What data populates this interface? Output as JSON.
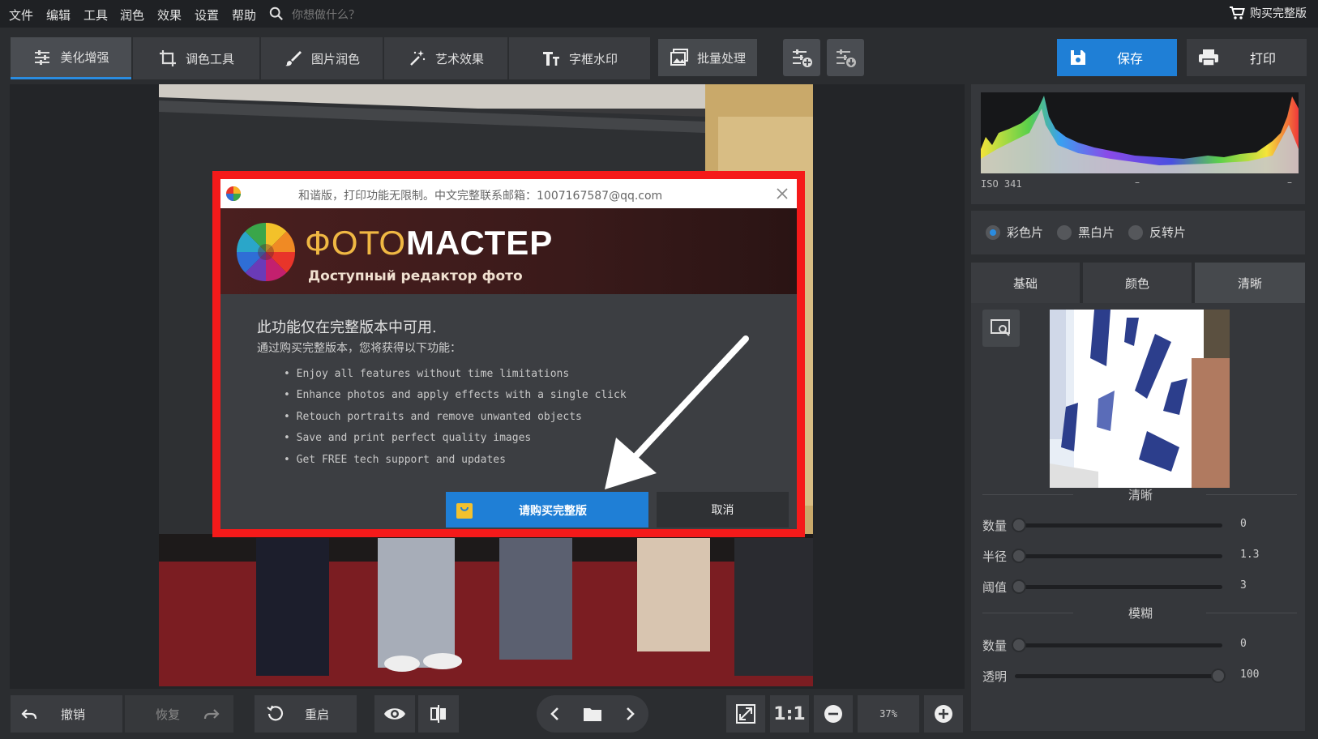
{
  "menu": {
    "items": [
      "文件",
      "编辑",
      "工具",
      "润色",
      "效果",
      "设置",
      "帮助"
    ],
    "search_placeholder": "你想做什么？",
    "buy_label": "购买完整版"
  },
  "toolbar": {
    "tabs": [
      "美化增强",
      "调色工具",
      "图片润色",
      "艺术效果",
      "字框水印"
    ],
    "batch_label": "批量处理",
    "save_label": "保存",
    "print_label": "打印"
  },
  "dialog": {
    "title": "和谐版，打印功能无限制。中文完整联系邮箱：1007167587@qq.com",
    "brand_part1": "ФОТО",
    "brand_part2": "МАСТЕР",
    "brand_subtitle": "Доступный редактор фото",
    "heading": "此功能仅在完整版本中可用.",
    "subheading": "通过购买完整版本，您将获得以下功能：",
    "features": [
      "• Enjoy all features without time limitations",
      "• Enhance photos and apply effects with a single click",
      "• Retouch portraits and remove unwanted objects",
      "• Save and print perfect quality images",
      "• Get FREE tech support and updates"
    ],
    "buy_button": "请购买完整版",
    "cancel_button": "取消"
  },
  "histogram": {
    "iso": "ISO 341",
    "mid": "–",
    "right": "–"
  },
  "color_mode": {
    "options": [
      "彩色片",
      "黑白片",
      "反转片"
    ],
    "selected": 0
  },
  "panel_tabs": {
    "labels": [
      "基础",
      "颜色",
      "清晰"
    ],
    "active": 2
  },
  "sharpen": {
    "title": "清晰",
    "sliders": [
      {
        "label": "数量",
        "value": "0",
        "fraction": 0.0
      },
      {
        "label": "半径",
        "value": "1.3",
        "fraction": 0.0
      },
      {
        "label": "阈值",
        "value": "3",
        "fraction": 0.0
      }
    ]
  },
  "blur": {
    "title": "模糊",
    "sliders": [
      {
        "label": "数量",
        "value": "0",
        "fraction": 0.0
      },
      {
        "label": "透明",
        "value": "100",
        "fraction": 1.0
      }
    ]
  },
  "bottom": {
    "undo_label": "撤销",
    "redo_label": "恢复",
    "reset_label": "重启",
    "fit_label": "1:1",
    "zoom_value": "37%"
  },
  "colors": {
    "accent": "#1f7fd6",
    "highlight": "#f51a1a",
    "background": "#2b2d30"
  }
}
